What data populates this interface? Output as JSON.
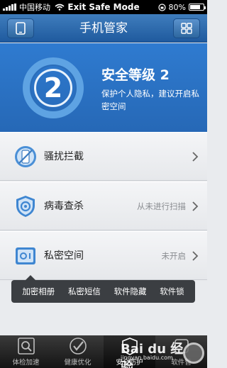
{
  "status_bar": {
    "carrier": "中国移动",
    "title": "Exit Safe Mode",
    "battery": "80%",
    "battery_level": 0.8
  },
  "header": {
    "title": "手机管家"
  },
  "hero": {
    "score": "2",
    "level_label": "安全等级 2",
    "description": "保护个人隐私，建议开启私密空间"
  },
  "rows": [
    {
      "label": "骚扰拦截",
      "status": ""
    },
    {
      "label": "病毒查杀",
      "status": "从未进行扫描"
    },
    {
      "label": "私密空间",
      "status": "未开启"
    }
  ],
  "tooltip": {
    "items": [
      "加密相册",
      "私密短信",
      "软件隐藏",
      "软件锁"
    ]
  },
  "tabs": [
    {
      "label": "体检加速",
      "active": false
    },
    {
      "label": "健康优化",
      "active": false
    },
    {
      "label": "安全防护",
      "active": true
    },
    {
      "label": "软件管",
      "active": false
    }
  ],
  "watermark": {
    "logo": "Bai du 经验",
    "url": "jingyan.baidu.com"
  },
  "colors": {
    "hero_blue": "#2a6fc0",
    "header_blue": "#2f6aab",
    "accent": "#5ea3e3"
  }
}
